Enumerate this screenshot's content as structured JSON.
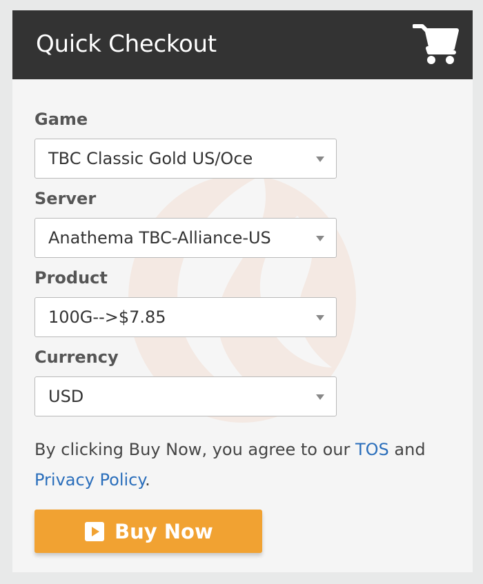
{
  "header": {
    "title": "Quick Checkout",
    "cart_icon": "shopping-cart-icon"
  },
  "form": {
    "game": {
      "label": "Game",
      "value": "TBC Classic Gold US/Oce"
    },
    "server": {
      "label": "Server",
      "value": "Anathema TBC-Alliance-US"
    },
    "product": {
      "label": "Product",
      "value": "100G-->$7.85"
    },
    "currency": {
      "label": "Currency",
      "value": "USD"
    }
  },
  "agreement": {
    "prefix": "By clicking Buy Now, you agree to our ",
    "tos_link": "TOS",
    "middle": " and ",
    "privacy_link": "Privacy Policy",
    "suffix": "."
  },
  "buy_button": {
    "label": "Buy Now",
    "icon": "play-square-icon"
  },
  "colors": {
    "header_bg": "#333333",
    "accent": "#f1a232",
    "link": "#2a6ebb"
  }
}
